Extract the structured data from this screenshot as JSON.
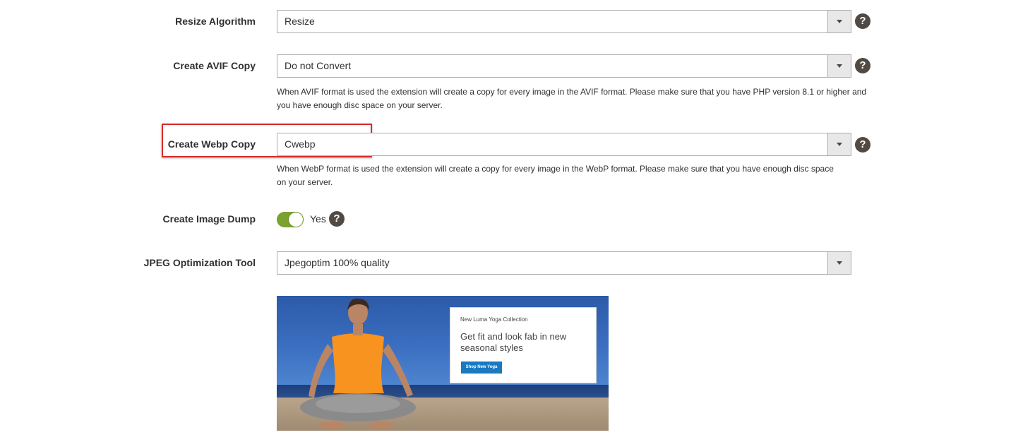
{
  "fields": {
    "resize_algorithm": {
      "label": "Resize Algorithm",
      "value": "Resize"
    },
    "avif_copy": {
      "label": "Create AVIF Copy",
      "value": "Do not Convert",
      "note": "When AVIF format is used the extension will create a copy for every image in the AVIF format. Please make sure that you have PHP version 8.1 or higher and you have enough disc space on your server."
    },
    "webp_copy": {
      "label": "Create Webp Copy",
      "value": "Cwebp",
      "note": "When WebP format is used the extension will create a copy for every image in the WebP format. Please make sure that you have enough disc space on your server."
    },
    "image_dump": {
      "label": "Create Image Dump",
      "toggle_on": true,
      "toggle_text": "Yes"
    },
    "jpeg_tool": {
      "label": "JPEG Optimization Tool",
      "value": "Jpegoptim 100% quality"
    }
  },
  "help_glyph": "?",
  "banner": {
    "eyebrow": "New Luma Yoga Collection",
    "headline": "Get fit and look fab in new seasonal styles",
    "cta": "Shop New Yoga"
  },
  "colors": {
    "toggle_on": "#79a22e",
    "highlight": "#d62b2b",
    "help_icon": "#514943",
    "cta": "#1979c3"
  }
}
